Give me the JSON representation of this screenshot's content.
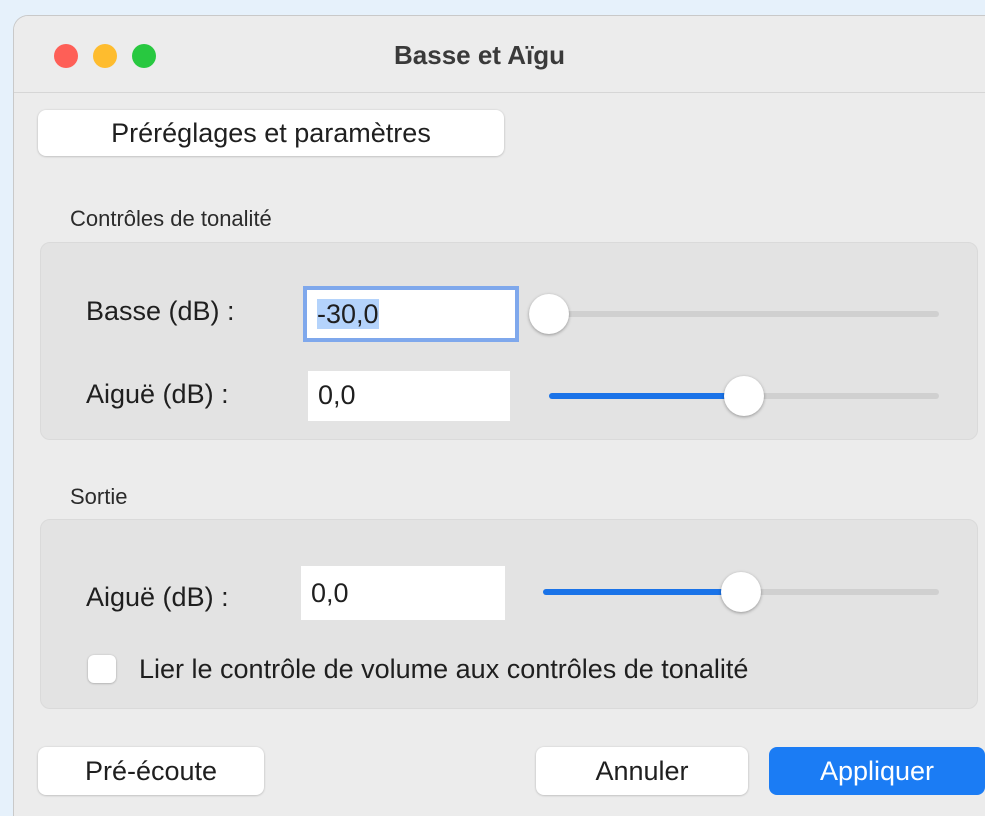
{
  "window": {
    "title": "Basse et Aïgu"
  },
  "toolbar": {
    "presets_label": "Préréglages et paramètres"
  },
  "tone_controls": {
    "section_label": "Contrôles de tonalité",
    "bass": {
      "label": "Basse (dB) :",
      "value": "-30,0",
      "slider_fraction": 0.0
    },
    "treble": {
      "label": "Aiguë (dB) :",
      "value": "0,0",
      "slider_fraction": 0.5
    }
  },
  "output": {
    "section_label": "Sortie",
    "volume": {
      "label": "Aiguë (dB) :",
      "value": "0,0",
      "slider_fraction": 0.5
    },
    "link_checkbox": {
      "label": "Lier le contrôle de volume aux contrôles de tonalité",
      "checked": false
    }
  },
  "footer": {
    "preview_label": "Pré-écoute",
    "cancel_label": "Annuler",
    "apply_label": "Appliquer"
  },
  "colors": {
    "accent": "#1b7cf4",
    "focus_ring": "#7fa8ec"
  }
}
